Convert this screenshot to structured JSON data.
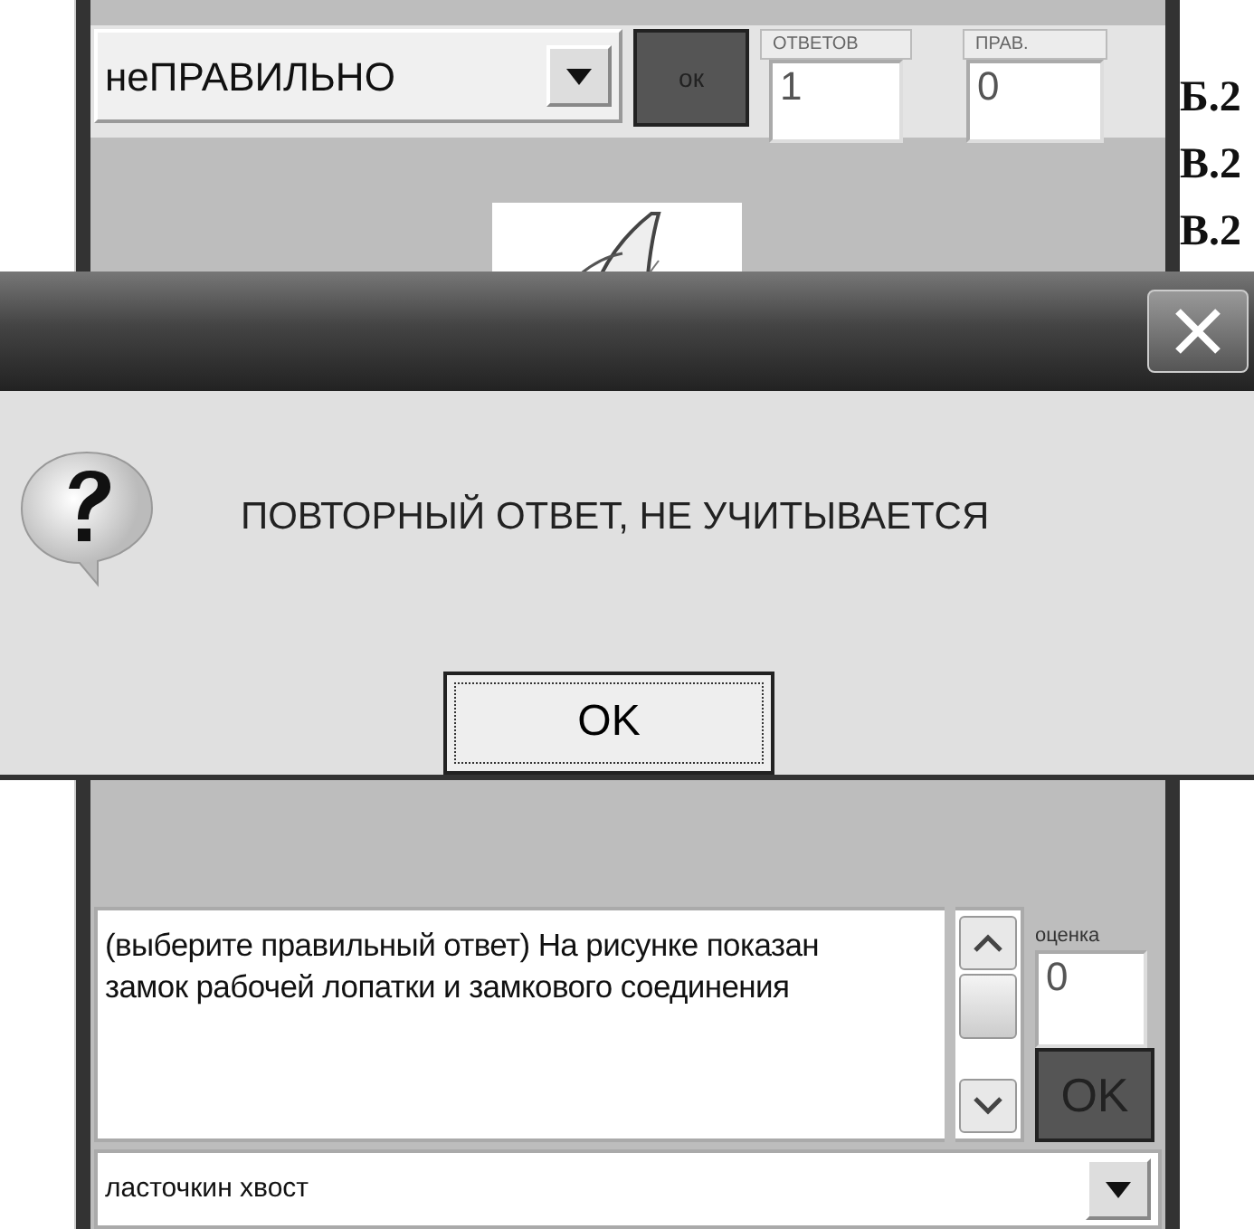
{
  "app": {
    "verdict_select": {
      "value": "неПРАВИЛЬНО"
    },
    "verdict_ok": "ок",
    "answers": {
      "label": "ОТВЕТОВ",
      "value": "1"
    },
    "correct": {
      "label": "ПРАВ.",
      "value": "0"
    },
    "side_list": [
      "Б.2",
      "В.2",
      "В.2"
    ],
    "question": "(выберите правильный ответ) На рисунке показан  замок рабочей лопатки  и замкового соединения",
    "score": {
      "label": "оценка",
      "value": "0"
    },
    "score_ok": "OK",
    "answer_select": {
      "value": "ласточкин хвост"
    }
  },
  "dialog": {
    "message": "ПОВТОРНЫЙ ОТВЕТ, НЕ УЧИТЫВАЕТСЯ",
    "button": "OK"
  }
}
